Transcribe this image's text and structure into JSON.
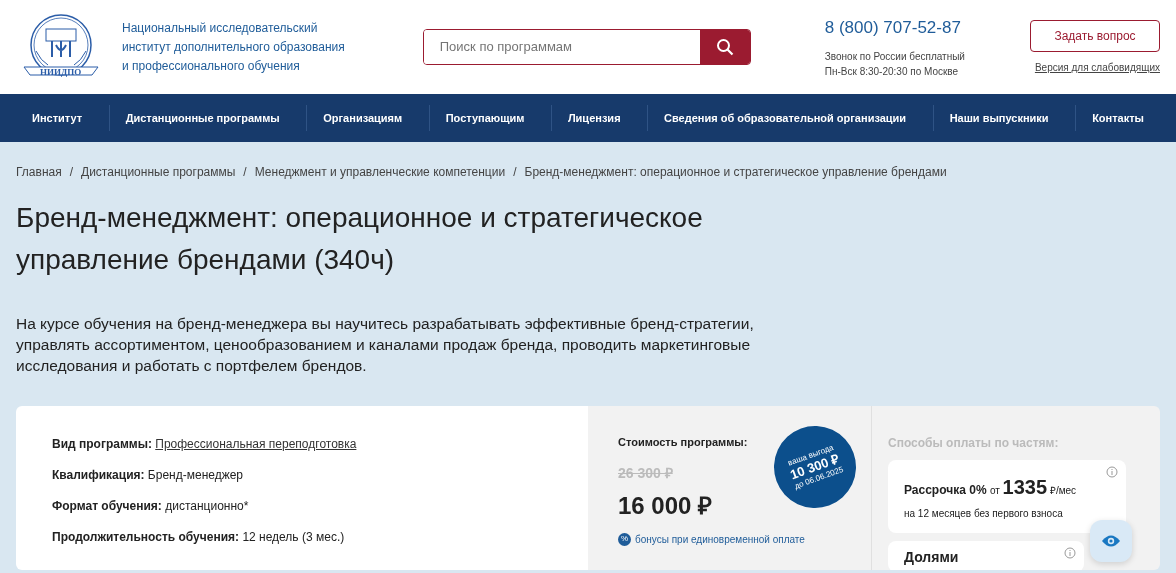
{
  "header": {
    "logo_caption": "НИИДПО",
    "org_name": [
      "Национальный исследовательский",
      "институт дополнительного образования",
      "и профессионального обучения"
    ],
    "search": {
      "placeholder": "Поиск по программам"
    },
    "phone": "8 (800) 707-52-87",
    "phone_notes": [
      "Звонок по России бесплатный",
      "Пн-Вск 8:30-20:30 по Москве"
    ],
    "ask_button": "Задать вопрос",
    "accessibility_link": "Версия для слабовидящих"
  },
  "nav": [
    {
      "label": "Институт"
    },
    {
      "label": "Дистанционные программы"
    },
    {
      "label": "Организациям"
    },
    {
      "label": "Поступающим"
    },
    {
      "label": "Лицензия"
    },
    {
      "label": "Сведения об образовательной организации"
    },
    {
      "label": "Наши выпускники"
    },
    {
      "label": "Контакты"
    }
  ],
  "breadcrumbs": {
    "separator": "/",
    "items": [
      "Главная",
      "Дистанционные программы",
      "Менеджмент и управленческие компетенции",
      "Бренд-менеджмент: операционное и стратегическое управление брендами"
    ]
  },
  "title": "Бренд-менеджмент: операционное и стратегическое управление брендами (340ч)",
  "description": "На курсе обучения на бренд-менеджера вы научитесь разрабатывать эффективные бренд-стратегии, управлять ассортиментом, ценообразованием и каналами продаж бренда, проводить маркетинговые исследования и работать с портфелем брендов.",
  "details": [
    {
      "label": "Вид программы:",
      "value": "Профессиональная переподготовка",
      "kind": "link"
    },
    {
      "label": "Квалификация:",
      "value": "Бренд-менеджер",
      "kind": "text"
    },
    {
      "label": "Формат обучения:",
      "value": "дистанционно*",
      "kind": "text"
    },
    {
      "label": "Продолжительность обучения:",
      "value": "12 недель (3 мес.)",
      "kind": "text"
    }
  ],
  "price": {
    "label": "Стоимость программы:",
    "old": "26 300 ₽",
    "current": "16 000 ₽",
    "bonus_icon": "%",
    "bonus": "бонусы при единовременной оплате",
    "badge": [
      "ваша выгода",
      "10 300 ₽",
      "до 06.06.2025"
    ]
  },
  "installments": {
    "title": "Способы оплаты по частям:",
    "options": [
      {
        "name": "Рассрочка 0%",
        "from": "от",
        "amount": "1335",
        "unit": "₽/мес",
        "note": "на 12 месяцев без первого взноса"
      },
      {
        "name": "Долями"
      }
    ]
  }
}
